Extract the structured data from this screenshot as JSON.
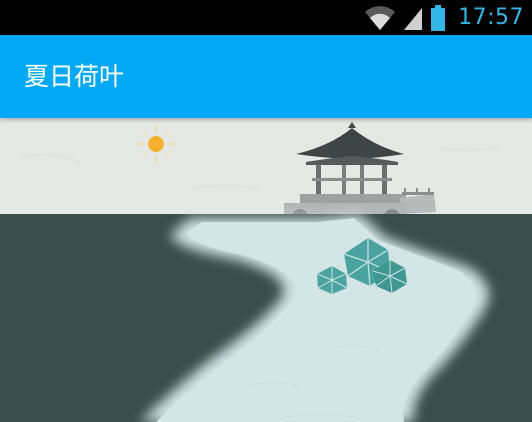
{
  "status_bar": {
    "time": "17:57",
    "icons": [
      "wifi-icon",
      "cell-signal-icon",
      "battery-icon"
    ],
    "accent_color": "#33b5e5"
  },
  "app_bar": {
    "title": "夏日荷叶",
    "background_color": "#03a9f4"
  },
  "scene": {
    "elements": [
      "sun",
      "pavilion",
      "river",
      "lotus-leaves"
    ],
    "sky_color": "#e6e8e5",
    "bank_color": "#3b4c4c",
    "water_color": "#d0e3e2",
    "leaf_color": "#4aa3a0"
  }
}
